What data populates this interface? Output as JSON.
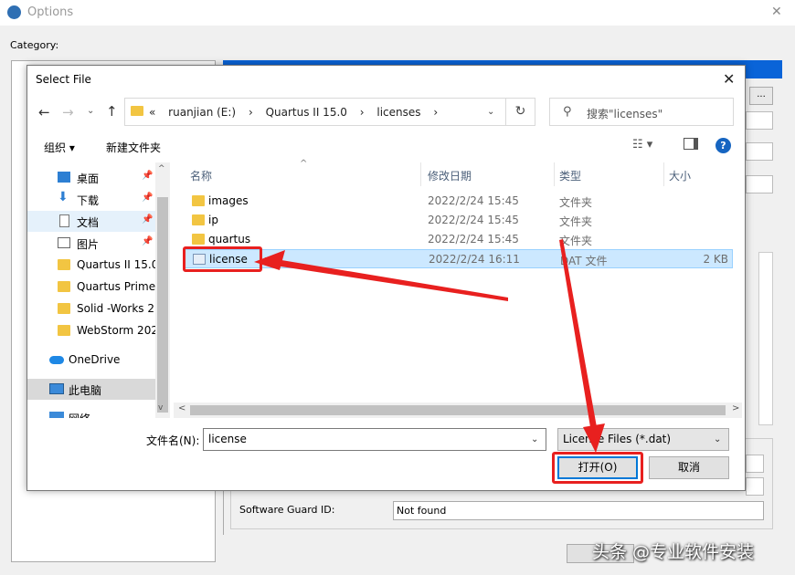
{
  "options_window": {
    "title": "Options",
    "category_label": "Category:",
    "browse_button": "...",
    "guard_label": "Software Guard ID:",
    "guard_value": "Not found"
  },
  "dialog": {
    "title": "Select File",
    "address": {
      "crumbs": [
        "«",
        "ruanjian (E:)",
        "›",
        "Quartus II 15.0",
        "›",
        "licenses",
        "›"
      ]
    },
    "search_placeholder": "搜索\"licenses\"",
    "toolbar": {
      "organize": "组织 ▾",
      "new_folder": "新建文件夹",
      "view_icon": "view-options-icon",
      "help": "?"
    },
    "nav": [
      {
        "label": "桌面",
        "icon": "desktop-icon",
        "pinned": true
      },
      {
        "label": "下载",
        "icon": "download-icon",
        "pinned": true
      },
      {
        "label": "文档",
        "icon": "document-icon",
        "pinned": true,
        "selected": true
      },
      {
        "label": "图片",
        "icon": "picture-icon",
        "pinned": true
      },
      {
        "label": "Quartus II 15.0",
        "icon": "folder-icon"
      },
      {
        "label": "Quartus Prime",
        "icon": "folder-icon"
      },
      {
        "label": "Solid -Works 2",
        "icon": "folder-icon"
      },
      {
        "label": "WebStorm 202",
        "icon": "folder-icon"
      },
      {
        "label": "OneDrive",
        "icon": "cloud-icon"
      },
      {
        "label": "此电脑",
        "icon": "computer-icon",
        "selected": true
      },
      {
        "label": "网络",
        "icon": "network-icon"
      }
    ],
    "columns": [
      "名称",
      "修改日期",
      "类型",
      "大小"
    ],
    "files": [
      {
        "name": "images",
        "date": "2022/2/24 15:45",
        "type": "文件夹",
        "size": "",
        "icon": "folder-icon"
      },
      {
        "name": "ip",
        "date": "2022/2/24 15:45",
        "type": "文件夹",
        "size": "",
        "icon": "folder-icon"
      },
      {
        "name": "quartus",
        "date": "2022/2/24 15:45",
        "type": "文件夹",
        "size": "",
        "icon": "folder-icon"
      },
      {
        "name": "license",
        "date": "2022/2/24 16:11",
        "type": "DAT 文件",
        "size": "2 KB",
        "icon": "dat-file-icon",
        "selected": true
      }
    ],
    "filename_label": "文件名(N):",
    "filename_value": "license",
    "filetype_value": "License Files (*.dat)",
    "open_button": "打开(O)",
    "cancel_button": "取消"
  },
  "watermark": "头条 @专业软件安装",
  "colors": {
    "accent": "#0078d7",
    "selection": "#cce8ff",
    "annotation": "#e8201f"
  }
}
